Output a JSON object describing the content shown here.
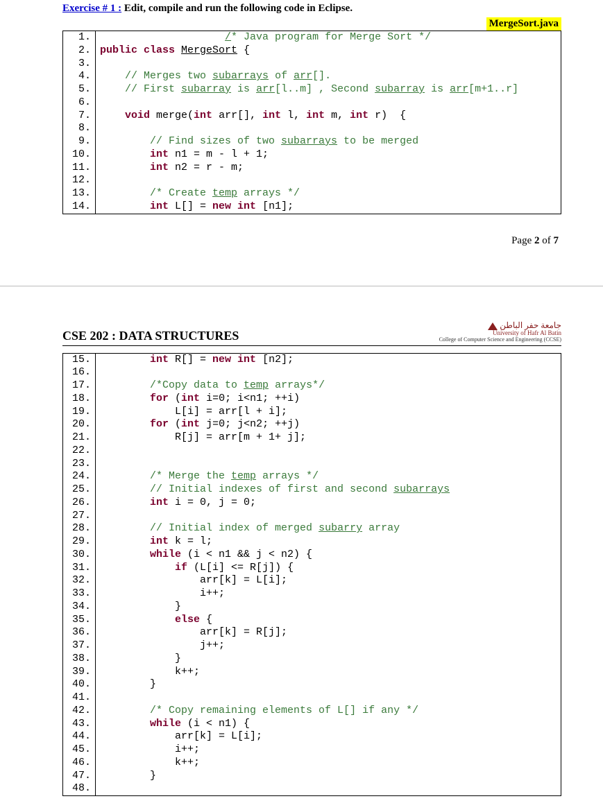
{
  "exercise": {
    "label": "Exercise # 1 :",
    "instruction": " Edit, compile and run the following code in Eclipse."
  },
  "filename": "MergeSort.java",
  "code1": {
    "start": 1,
    "lines": [
      {
        "indent": "                    ",
        "seg": [
          {
            "t": "/",
            "c": "c-und c-comment"
          },
          {
            "t": "* Java program for Merge Sort */",
            "c": "c-comment"
          }
        ]
      },
      {
        "indent": "",
        "seg": [
          {
            "t": "public class ",
            "c": "c-kw"
          },
          {
            "t": "MergeSort",
            "c": "c-und"
          },
          {
            "t": " {"
          }
        ]
      },
      {
        "indent": "",
        "seg": []
      },
      {
        "indent": "    ",
        "seg": [
          {
            "t": "// Merges two ",
            "c": "c-comment"
          },
          {
            "t": "subarrays",
            "c": "c-comment c-und"
          },
          {
            "t": " of ",
            "c": "c-comment"
          },
          {
            "t": "arr",
            "c": "c-comment c-und"
          },
          {
            "t": "[].",
            "c": "c-comment"
          }
        ]
      },
      {
        "indent": "    ",
        "seg": [
          {
            "t": "// First ",
            "c": "c-comment"
          },
          {
            "t": "subarray",
            "c": "c-comment c-und"
          },
          {
            "t": " is ",
            "c": "c-comment"
          },
          {
            "t": "arr",
            "c": "c-comment c-und"
          },
          {
            "t": "[l..m] , Second ",
            "c": "c-comment"
          },
          {
            "t": "subarray",
            "c": "c-comment c-und"
          },
          {
            "t": " is ",
            "c": "c-comment"
          },
          {
            "t": "arr",
            "c": "c-comment c-und"
          },
          {
            "t": "[m+1..r]",
            "c": "c-comment"
          }
        ]
      },
      {
        "indent": "",
        "seg": []
      },
      {
        "indent": "    ",
        "seg": [
          {
            "t": "void ",
            "c": "c-kw"
          },
          {
            "t": "merge("
          },
          {
            "t": "int ",
            "c": "c-kw"
          },
          {
            "t": "arr[], "
          },
          {
            "t": "int ",
            "c": "c-kw"
          },
          {
            "t": "l, "
          },
          {
            "t": "int ",
            "c": "c-kw"
          },
          {
            "t": "m, "
          },
          {
            "t": "int ",
            "c": "c-kw"
          },
          {
            "t": "r)  {"
          }
        ]
      },
      {
        "indent": "",
        "seg": []
      },
      {
        "indent": "        ",
        "seg": [
          {
            "t": "// Find sizes of two ",
            "c": "c-comment"
          },
          {
            "t": "subarrays",
            "c": "c-comment c-und"
          },
          {
            "t": " to be merged",
            "c": "c-comment"
          }
        ]
      },
      {
        "indent": "        ",
        "seg": [
          {
            "t": "int ",
            "c": "c-kw"
          },
          {
            "t": "n1 = m - l + 1;"
          }
        ]
      },
      {
        "indent": "        ",
        "seg": [
          {
            "t": "int ",
            "c": "c-kw"
          },
          {
            "t": "n2 = r - m;"
          }
        ]
      },
      {
        "indent": "",
        "seg": []
      },
      {
        "indent": "        ",
        "seg": [
          {
            "t": "/* Create ",
            "c": "c-comment"
          },
          {
            "t": "temp",
            "c": "c-comment c-und"
          },
          {
            "t": " arrays */",
            "c": "c-comment"
          }
        ]
      },
      {
        "indent": "        ",
        "seg": [
          {
            "t": "int ",
            "c": "c-kw"
          },
          {
            "t": "L[] = "
          },
          {
            "t": "new int ",
            "c": "c-kw"
          },
          {
            "t": "[n1];"
          }
        ]
      }
    ]
  },
  "pagenum": {
    "pre": "Page ",
    "b1": "2",
    "mid": " of ",
    "b2": "7"
  },
  "course": "CSE 202 : DATA STRUCTURES",
  "uni": {
    "ar": "جامعة حفر الباطن",
    "en": "University of Hafr Al Batin",
    "col": "College of Computer Science and Engineering (CCSE)"
  },
  "code2": {
    "start": 15,
    "lines": [
      {
        "indent": "        ",
        "seg": [
          {
            "t": "int ",
            "c": "c-kw"
          },
          {
            "t": "R[] = "
          },
          {
            "t": "new int ",
            "c": "c-kw"
          },
          {
            "t": "[n2];"
          }
        ]
      },
      {
        "indent": "",
        "seg": []
      },
      {
        "indent": "        ",
        "seg": [
          {
            "t": "/*Copy data to ",
            "c": "c-comment"
          },
          {
            "t": "temp",
            "c": "c-comment c-und"
          },
          {
            "t": " arrays*/",
            "c": "c-comment"
          }
        ]
      },
      {
        "indent": "        ",
        "seg": [
          {
            "t": "for ",
            "c": "c-kw"
          },
          {
            "t": "("
          },
          {
            "t": "int ",
            "c": "c-kw"
          },
          {
            "t": "i=0; i<n1; ++i)"
          }
        ]
      },
      {
        "indent": "            ",
        "seg": [
          {
            "t": "L[i] = arr[l + i];"
          }
        ]
      },
      {
        "indent": "        ",
        "seg": [
          {
            "t": "for ",
            "c": "c-kw"
          },
          {
            "t": "("
          },
          {
            "t": "int ",
            "c": "c-kw"
          },
          {
            "t": "j=0; j<n2; ++j)"
          }
        ]
      },
      {
        "indent": "            ",
        "seg": [
          {
            "t": "R[j] = arr[m + 1+ j];"
          }
        ]
      },
      {
        "indent": "",
        "seg": []
      },
      {
        "indent": "",
        "seg": []
      },
      {
        "indent": "        ",
        "seg": [
          {
            "t": "/* Merge the ",
            "c": "c-comment"
          },
          {
            "t": "temp",
            "c": "c-comment c-und"
          },
          {
            "t": " arrays */",
            "c": "c-comment"
          }
        ]
      },
      {
        "indent": "        ",
        "seg": [
          {
            "t": "// Initial indexes of first and second ",
            "c": "c-comment"
          },
          {
            "t": "subarrays",
            "c": "c-comment c-und"
          }
        ]
      },
      {
        "indent": "        ",
        "seg": [
          {
            "t": "int ",
            "c": "c-kw"
          },
          {
            "t": "i = 0, j = 0;"
          }
        ]
      },
      {
        "indent": "",
        "seg": []
      },
      {
        "indent": "        ",
        "seg": [
          {
            "t": "// Initial index of merged ",
            "c": "c-comment"
          },
          {
            "t": "subarry",
            "c": "c-comment c-und"
          },
          {
            "t": " array",
            "c": "c-comment"
          }
        ]
      },
      {
        "indent": "        ",
        "seg": [
          {
            "t": "int ",
            "c": "c-kw"
          },
          {
            "t": "k = l;"
          }
        ]
      },
      {
        "indent": "        ",
        "seg": [
          {
            "t": "while ",
            "c": "c-kw"
          },
          {
            "t": "(i < n1 && j < n2) {"
          }
        ]
      },
      {
        "indent": "            ",
        "seg": [
          {
            "t": "if ",
            "c": "c-kw"
          },
          {
            "t": "(L[i] <= R[j]) {"
          }
        ]
      },
      {
        "indent": "                ",
        "seg": [
          {
            "t": "arr[k] = L[i];"
          }
        ]
      },
      {
        "indent": "                ",
        "seg": [
          {
            "t": "i++;"
          }
        ]
      },
      {
        "indent": "            ",
        "seg": [
          {
            "t": "}"
          }
        ]
      },
      {
        "indent": "            ",
        "seg": [
          {
            "t": "else ",
            "c": "c-kw"
          },
          {
            "t": "{"
          }
        ]
      },
      {
        "indent": "                ",
        "seg": [
          {
            "t": "arr[k] = R[j];"
          }
        ]
      },
      {
        "indent": "                ",
        "seg": [
          {
            "t": "j++;"
          }
        ]
      },
      {
        "indent": "            ",
        "seg": [
          {
            "t": "}"
          }
        ]
      },
      {
        "indent": "            ",
        "seg": [
          {
            "t": "k++;"
          }
        ]
      },
      {
        "indent": "        ",
        "seg": [
          {
            "t": "}"
          }
        ]
      },
      {
        "indent": "",
        "seg": []
      },
      {
        "indent": "        ",
        "seg": [
          {
            "t": "/* Copy remaining elements of L[] if any */",
            "c": "c-comment"
          }
        ]
      },
      {
        "indent": "        ",
        "seg": [
          {
            "t": "while ",
            "c": "c-kw"
          },
          {
            "t": "(i < n1) {"
          }
        ]
      },
      {
        "indent": "            ",
        "seg": [
          {
            "t": "arr[k] = L[i];"
          }
        ]
      },
      {
        "indent": "            ",
        "seg": [
          {
            "t": "i++;"
          }
        ]
      },
      {
        "indent": "            ",
        "seg": [
          {
            "t": "k++;"
          }
        ]
      },
      {
        "indent": "        ",
        "seg": [
          {
            "t": "}"
          }
        ]
      },
      {
        "indent": "",
        "seg": []
      }
    ]
  }
}
